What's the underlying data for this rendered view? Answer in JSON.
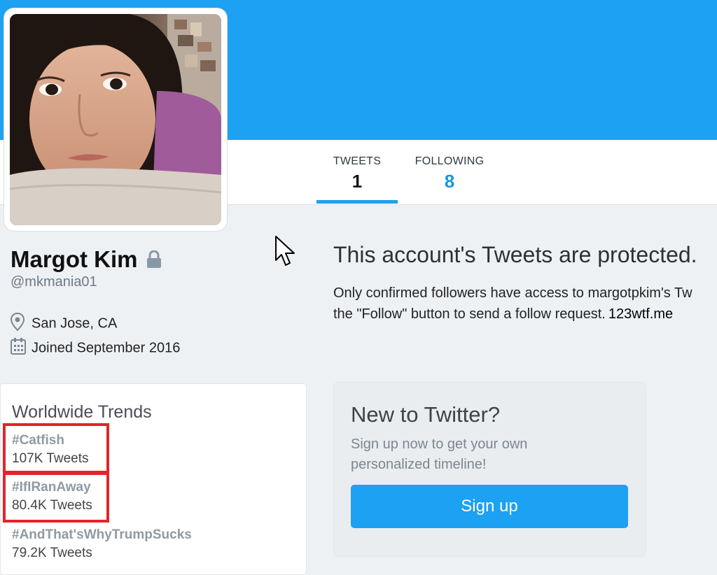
{
  "colors": {
    "brand": "#1da1f2",
    "following_value": "#1b95e0",
    "highlight": "#e3242b"
  },
  "profile": {
    "name": "Margot Kim",
    "handle": "@mkmania01",
    "location": "San Jose, CA",
    "joined": "Joined September 2016",
    "protected_icon": "lock-icon"
  },
  "stats": [
    {
      "label": "TWEETS",
      "value": "1",
      "active": true
    },
    {
      "label": "FOLLOWING",
      "value": "8",
      "active": false
    }
  ],
  "protected_notice": {
    "title": "This account's Tweets are protected.",
    "line1": "Only confirmed followers have access to margotpkim's Tw",
    "line2": "the \"Follow\" button to send a follow request.",
    "watermark": "123wtf.me"
  },
  "trends": {
    "title": "Worldwide Trends",
    "items": [
      {
        "tag": "#Catfish",
        "count": "107K Tweets",
        "highlighted": true
      },
      {
        "tag": "#IfIRanAway",
        "count": "80.4K Tweets",
        "highlighted": true
      },
      {
        "tag": "#AndThat'sWhyTrumpSucks",
        "count": "79.2K Tweets",
        "highlighted": false
      }
    ]
  },
  "signup": {
    "title": "New to Twitter?",
    "subtitle": "Sign up now to get your own personalized timeline!",
    "button_label": "Sign up"
  }
}
